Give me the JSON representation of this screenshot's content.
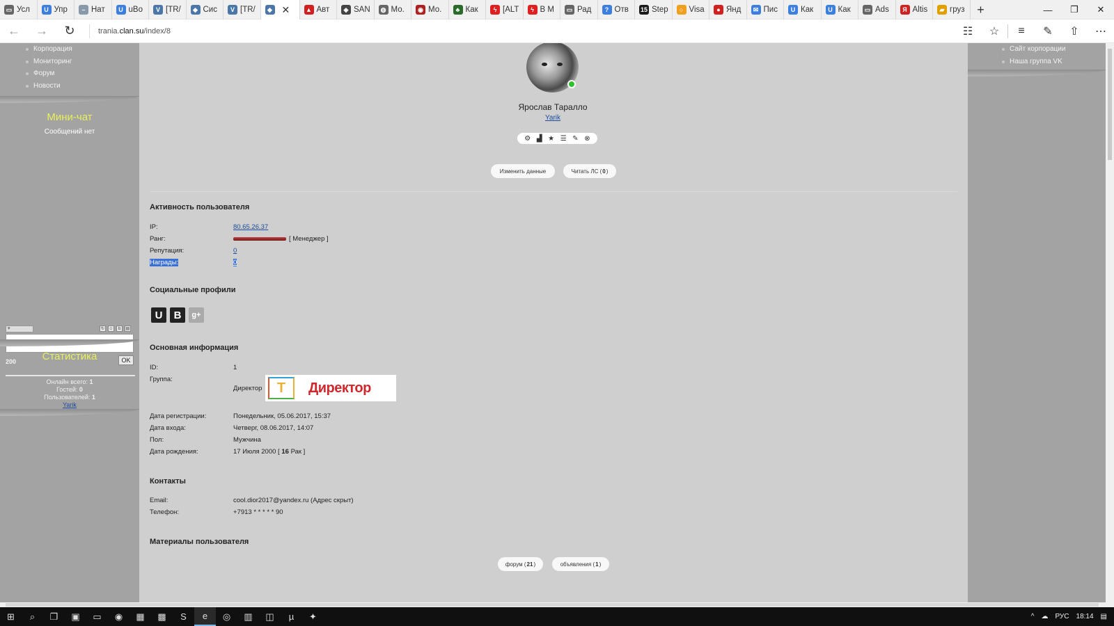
{
  "browser": {
    "tabs": [
      {
        "label": "Усл",
        "icon": "page-icon",
        "color": "#666666"
      },
      {
        "label": "Упр",
        "icon": "u-icon",
        "color": "#3d7fe0"
      },
      {
        "label": "Нат",
        "icon": "dash-icon",
        "color": "#8899aa"
      },
      {
        "label": "uBo",
        "icon": "u-icon",
        "color": "#3d7fe0"
      },
      {
        "label": "[TR/",
        "icon": "vk-icon",
        "color": "#4a76a8"
      },
      {
        "label": "Сис",
        "icon": "diamond-icon",
        "color": "#4a76a8"
      },
      {
        "label": "[TR/",
        "icon": "vk-icon",
        "color": "#4a76a8"
      },
      {
        "label": "",
        "icon": "diamond-icon",
        "color": "#4a76a8",
        "active": true
      },
      {
        "label": "Авт",
        "icon": "triangle-icon",
        "color": "#d02020"
      },
      {
        "label": "SAN",
        "icon": "shield-icon",
        "color": "#444444"
      },
      {
        "label": "Мо.",
        "icon": "globe-icon",
        "color": "#666666"
      },
      {
        "label": "Мо.",
        "icon": "badge-icon",
        "color": "#b02020"
      },
      {
        "label": "Как",
        "icon": "leaf-icon",
        "color": "#2a6a2a"
      },
      {
        "label": "[ALT",
        "icon": "bolt-icon",
        "color": "#e02020"
      },
      {
        "label": "В М",
        "icon": "bolt-icon",
        "color": "#e02020"
      },
      {
        "label": "Рад",
        "icon": "page-icon",
        "color": "#666666"
      },
      {
        "label": "Отв",
        "icon": "question-icon",
        "color": "#3d7fe0"
      },
      {
        "label": "Step",
        "icon": "15-icon",
        "color": "#1a1a1a"
      },
      {
        "label": "Visa",
        "icon": "circle-icon",
        "color": "#f0a020"
      },
      {
        "label": "Янд",
        "icon": "pin-icon",
        "color": "#d02020"
      },
      {
        "label": "Пис",
        "icon": "mail-icon",
        "color": "#3d7fe0"
      },
      {
        "label": "Как",
        "icon": "u-icon",
        "color": "#3d7fe0"
      },
      {
        "label": "Как",
        "icon": "u-icon",
        "color": "#3d7fe0"
      },
      {
        "label": "Ads",
        "icon": "page-icon",
        "color": "#666666"
      },
      {
        "label": "Altis",
        "icon": "yandex-icon",
        "color": "#d02020"
      },
      {
        "label": "груз",
        "icon": "truck-icon",
        "color": "#e0a000"
      }
    ],
    "new_tab": "+",
    "url_prefix": "trania.",
    "url_domain": "clan.su",
    "url_path": "/index/8"
  },
  "left": {
    "menu": [
      "Корпорация",
      "Мониторинг",
      "Форум",
      "Новости"
    ],
    "minichat_title": "Мини-чат",
    "minichat_empty": "Сообщений нет",
    "chat_count": "200",
    "chat_ok": "OK",
    "stats_title": "Статистика",
    "stats_online_label": "Онлайн всего:",
    "stats_online": "1",
    "stats_guests_label": "Гостей:",
    "stats_guests": "0",
    "stats_users_label": "Пользователей:",
    "stats_users": "1",
    "stats_user_link": "Yarik"
  },
  "right": {
    "menu": [
      "Сайт корпорации",
      "Наша группа VK"
    ]
  },
  "profile": {
    "name": "Ярослав Таралло",
    "login": "Yarik",
    "tools": [
      "gear-icon",
      "chart-icon",
      "star-icon",
      "list-icon",
      "pencil-icon",
      "close-circle-icon"
    ],
    "btn_edit": "Изменить данные",
    "btn_pm_label": "Читать ЛС (",
    "btn_pm_count": "0",
    "btn_pm_end": ")"
  },
  "activity": {
    "title": "Активность пользователя",
    "ip_label": "IP:",
    "ip": "80.65.26.37",
    "rank_label": "Ранг:",
    "rank": "[ Менеджер ]",
    "reputation_label": "Репутация:",
    "reputation": "0",
    "awards_label": "Награды:",
    "awards": "0"
  },
  "social": {
    "title": "Социальные профили",
    "icons": [
      {
        "letter": "U",
        "name": "ucoz-icon",
        "color": "#222222"
      },
      {
        "letter": "B",
        "name": "vk-icon",
        "color": "#222222"
      },
      {
        "letter": "g+",
        "name": "google-plus-icon",
        "color": "#aaaaaa"
      }
    ]
  },
  "info": {
    "title": "Основная информация",
    "id_label": "ID:",
    "id": "1",
    "group_label": "Группа:",
    "group": "Директор",
    "group_badge": "Директор",
    "group_badge_logo": "T",
    "reg_label": "Дата регистрации:",
    "reg": "Понедельник, 05.06.2017, 15:37",
    "login_label": "Дата входа:",
    "login": "Четверг, 08.06.2017, 14:07",
    "gender_label": "Пол:",
    "gender": "Мужчина",
    "birth_label": "Дата рождения:",
    "birth_date": "17 Июля 2000 [",
    "birth_age": "16",
    "birth_sign": "Рак ]"
  },
  "contacts": {
    "title": "Контакты",
    "email_label": "Email:",
    "email": "cool.dior2017@yandex.ru (Адрес скрыт)",
    "phone_label": "Телефон:",
    "phone": "+7913 * * * * * 90"
  },
  "materials": {
    "title": "Материалы пользователя",
    "forum_label": "форум (",
    "forum_count": "21",
    "ads_label": "объявления (",
    "ads_count": "1",
    "close": ")"
  },
  "taskbar": {
    "lang": "РУС",
    "time": "18:14"
  }
}
